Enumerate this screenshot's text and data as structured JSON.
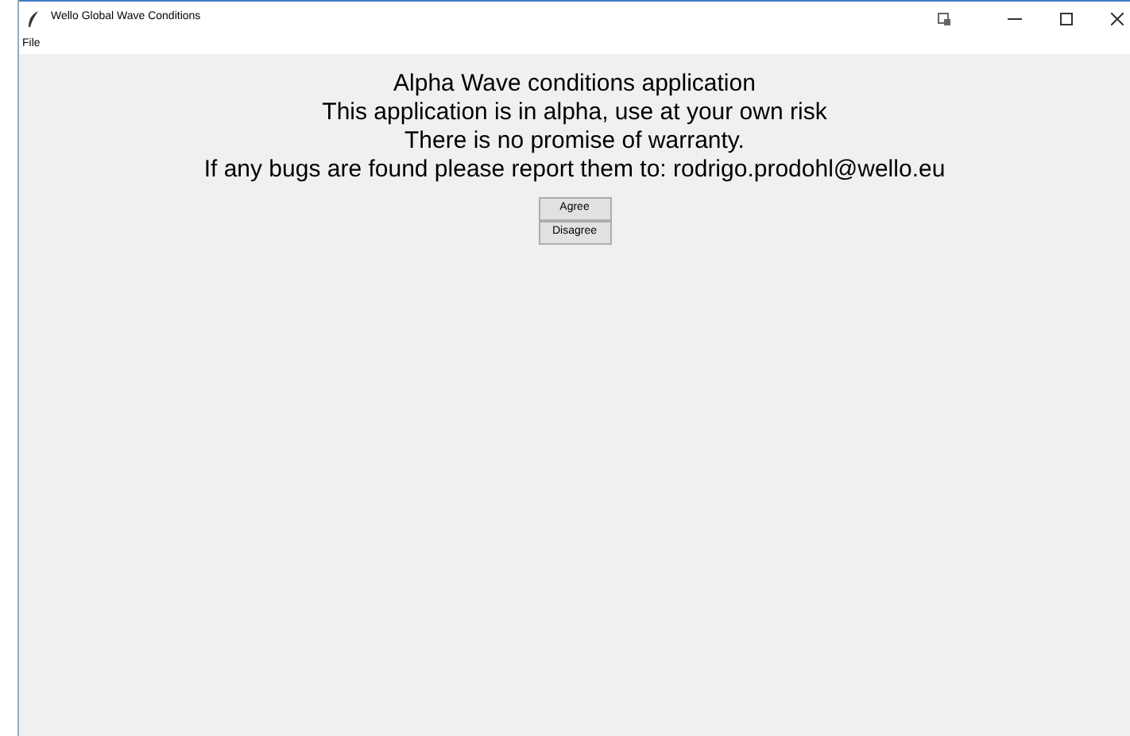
{
  "window": {
    "title": "Wello Global Wave Conditions"
  },
  "menu": [
    "File"
  ],
  "message": [
    "Alpha Wave conditions application",
    "This application is in alpha, use at your own risk",
    "There is no promise of warranty.",
    "If any bugs are found please report them to: rodrigo.prodohl@wello.eu"
  ],
  "buttons": [
    "Agree",
    "Disagree"
  ]
}
